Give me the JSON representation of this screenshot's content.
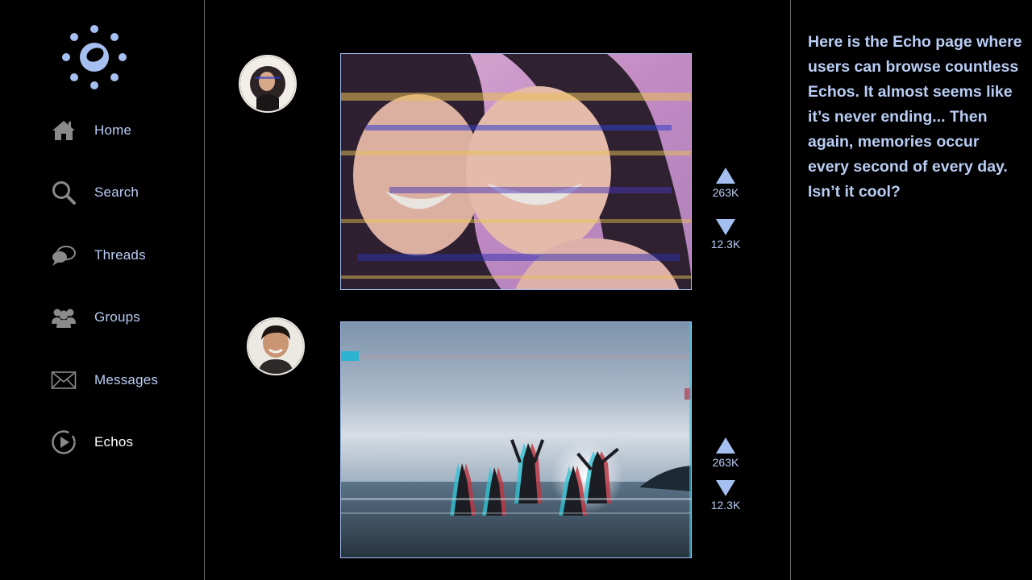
{
  "nav": {
    "items": [
      {
        "label": "Home",
        "icon": "home-icon"
      },
      {
        "label": "Search",
        "icon": "search-icon"
      },
      {
        "label": "Threads",
        "icon": "chat-bubbles-icon"
      },
      {
        "label": "Groups",
        "icon": "groups-icon"
      },
      {
        "label": "Messages",
        "icon": "envelope-icon"
      },
      {
        "label": "Echos",
        "icon": "play-circle-icon"
      }
    ],
    "active": "Echos"
  },
  "posts": [
    {
      "upvotes": "263K",
      "downvotes": "12.3K",
      "media": "glitch photo of two smiling women"
    },
    {
      "upvotes": "263K",
      "downvotes": "12.3K",
      "media": "glitch photo of people jumping on a beach at sunset"
    }
  ],
  "info": {
    "text": "Here is the Echo page where users can browse countless Echos. It almost seems like it’s never ending... Then again, memories occur every second of every day. Isn’t it cool?"
  },
  "colors": {
    "accent": "#a5c0f0",
    "text": "#b9cdf5",
    "background": "#000000",
    "divider": "#6b6b6b"
  }
}
